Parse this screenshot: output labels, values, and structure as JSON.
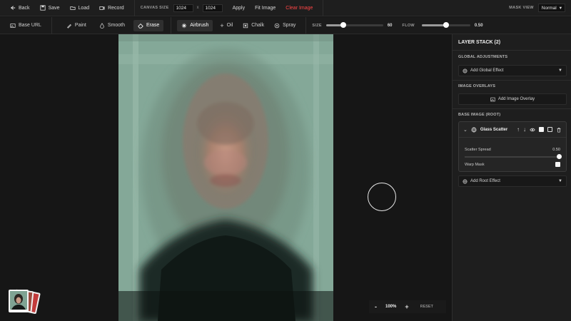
{
  "topbar": {
    "back": "Back",
    "save": "Save",
    "load": "Load",
    "record": "Record",
    "canvas_size_label": "CANVAS SIZE",
    "width": "1024",
    "height": "1024",
    "x": "x",
    "apply": "Apply",
    "fit_image": "Fit Image",
    "clear_image": "Clear Image",
    "mask_view_label": "MASK VIEW",
    "mask_view_value": "Normal"
  },
  "toolbar": {
    "base_url": "Base URL",
    "paint": "Paint",
    "smooth": "Smooth",
    "erase": "Erase",
    "airbrush": "Airbrush",
    "oil": "Oil",
    "chalk": "Chalk",
    "spray": "Spray",
    "size_label": "SIZE",
    "size_value": "60",
    "size_fraction": 0.3,
    "flow_label": "FLOW",
    "flow_value": "0.50",
    "flow_fraction": 0.5
  },
  "zoom": {
    "minus": "-",
    "value": "100%",
    "plus": "+",
    "reset": "RESET"
  },
  "panel": {
    "title": "LAYER STACK (2)",
    "global_label": "GLOBAL ADJUSTMENTS",
    "add_global": "Add Global Effect",
    "overlays_label": "IMAGE OVERLAYS",
    "add_overlay": "Add Image Overlay",
    "base_label": "BASE IMAGE (ROOT)",
    "layer": {
      "name": "Glass Scatter",
      "param_label": "Scatter Spread",
      "param_value": "0.50",
      "param_fraction": 1.0,
      "warp_label": "Warp Mask"
    },
    "add_root": "Add Root Effect"
  },
  "colors": {
    "accent_danger": "#ff4545",
    "canvas_bg": "#7fa393",
    "canvas_dark": "#101916"
  }
}
